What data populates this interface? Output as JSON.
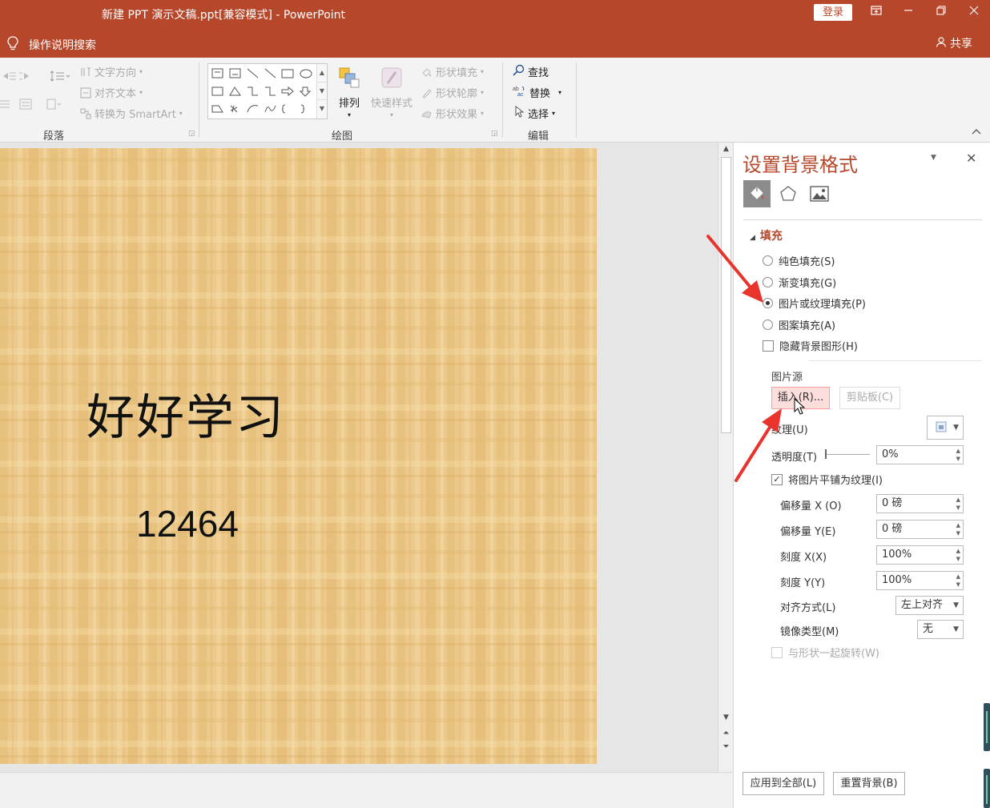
{
  "window": {
    "title": "新建 PPT 演示文稿.ppt[兼容模式]  -  PowerPoint",
    "login_label": "登录",
    "tell_me": "操作说明搜索",
    "share": "共享"
  },
  "ribbon": {
    "paragraph": {
      "label": "段落",
      "text_direction": "文字方向",
      "align_text": "对齐文本",
      "convert_smartart": "转换为 SmartArt"
    },
    "drawing": {
      "label": "绘图",
      "arrange": "排列",
      "quick_styles": "快速样式",
      "shape_fill": "形状填充",
      "shape_outline": "形状轮廓",
      "shape_effects": "形状效果"
    },
    "editing": {
      "label": "编辑",
      "find": "查找",
      "replace": "替换",
      "select": "选择"
    }
  },
  "slide": {
    "title": "好好学习",
    "number": "12464"
  },
  "pane": {
    "title": "设置背景格式",
    "section": "填充",
    "fill_options": [
      {
        "label": "纯色填充(S)",
        "selected": false
      },
      {
        "label": "渐变填充(G)",
        "selected": false
      },
      {
        "label": "图片或纹理填充(P)",
        "selected": true
      },
      {
        "label": "图案填充(A)",
        "selected": false
      }
    ],
    "hide_bg_graphics": "隐藏背景图形(H)",
    "picture_source": "图片源",
    "insert_button": "插入(R)...",
    "clipboard_button": "剪贴板(C)",
    "texture_label": "纹理(U)",
    "transparency_label": "透明度(T)",
    "transparency_value": "0%",
    "transparency_percent": 0,
    "tile_label": "将图片平铺为纹理(I)",
    "tile_checked": true,
    "offset_x_label": "偏移量 X (O)",
    "offset_x_value": "0 磅",
    "offset_y_label": "偏移量 Y(E)",
    "offset_y_value": "0 磅",
    "scale_x_label": "刻度 X(X)",
    "scale_x_value": "100%",
    "scale_y_label": "刻度 Y(Y)",
    "scale_y_value": "100%",
    "alignment_label": "对齐方式(L)",
    "alignment_value": "左上对齐",
    "mirror_label": "镜像类型(M)",
    "mirror_value": "无",
    "rotate_label": "与形状一起旋转(W)",
    "apply_all": "应用到全部(L)",
    "reset": "重置背景(B)"
  },
  "colors": {
    "accent": "#b7472a",
    "annotation_arrow": "#e8342c"
  }
}
